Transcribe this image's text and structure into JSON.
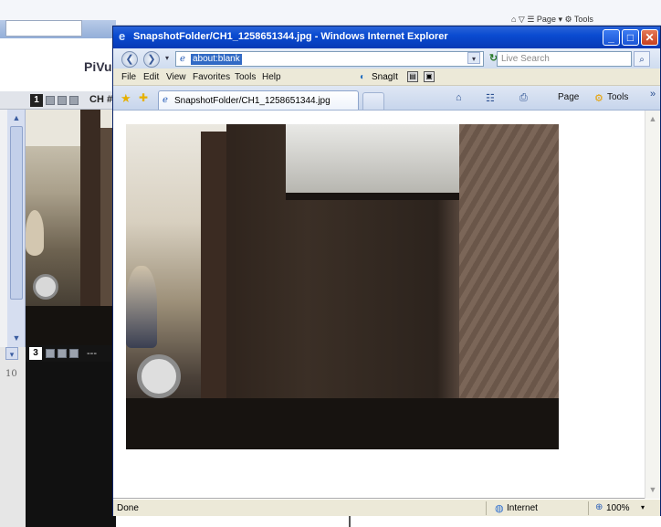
{
  "background": {
    "tools_fragment": "⌂ ▽ ☰ Page ▾ ⚙ Tools",
    "app_title_fragment": "PiVu",
    "channel_bar": {
      "channel_num": "1",
      "label": "CH #"
    },
    "channel3_bar": {
      "channel_num": "3",
      "label": "---"
    },
    "side_number": "10"
  },
  "window": {
    "title": "SnapshotFolder/CH1_1258651344.jpg - Windows Internet Explorer",
    "buttons": {
      "minimize": "_",
      "maximize": "□",
      "close": "✕"
    }
  },
  "address_bar": {
    "back": "❮",
    "forward": "❯",
    "url": "about:blank",
    "dropdown": "▾",
    "refresh": "↻",
    "stop": "✕",
    "search_placeholder": "Live Search",
    "search_icon": "⌕"
  },
  "menu": {
    "items": [
      "File",
      "Edit",
      "View",
      "Favorites",
      "Tools",
      "Help"
    ],
    "snagit": "SnagIt"
  },
  "tabs": {
    "active_label": "SnapshotFolder/CH1_1258651344.jpg"
  },
  "toolbar": {
    "home": "⌂",
    "feeds": "☷",
    "print": "⎙",
    "page": "Page",
    "tools": "Tools",
    "more": "»"
  },
  "status": {
    "text": "Done",
    "zone": "Internet",
    "zoom": "100%"
  },
  "colors": {
    "titlebar": "#0a4bd1",
    "close_button": "#c6401f",
    "address_highlight": "#316ac5"
  }
}
